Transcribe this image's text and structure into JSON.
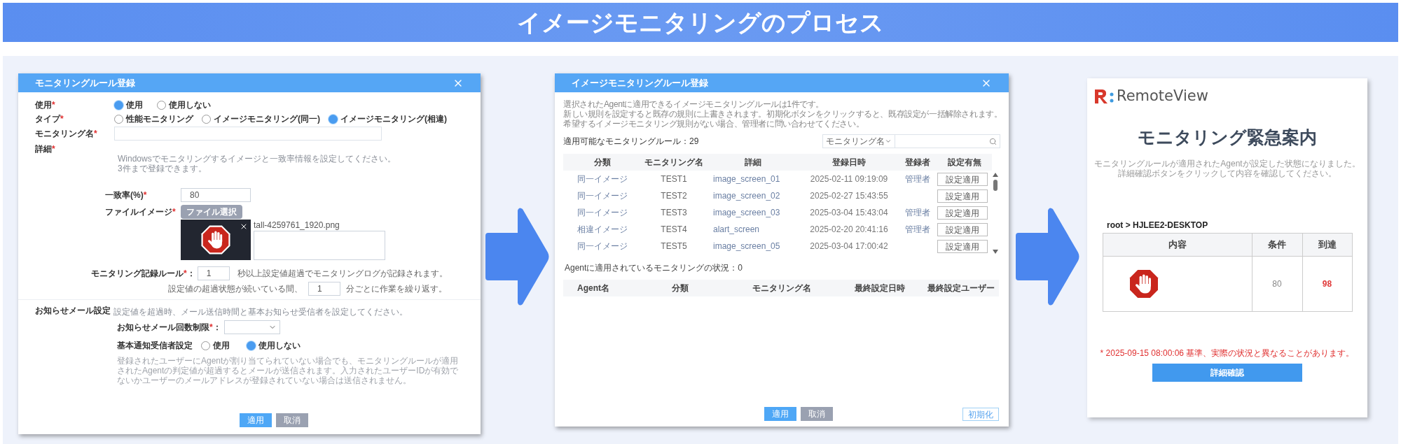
{
  "banner": {
    "title": "イメージモニタリングのプロセス"
  },
  "rule_dialog": {
    "title": "モニタリングルール登録",
    "use": {
      "label": "使用",
      "mark": "*",
      "options": [
        {
          "label": "使用",
          "selected": true
        },
        {
          "label": "使用しない",
          "selected": false
        }
      ]
    },
    "type": {
      "label": "タイプ",
      "mark": "*",
      "options": [
        {
          "label": "性能モニタリング",
          "selected": false
        },
        {
          "label": "イメージモニタリング(同一)",
          "selected": false
        },
        {
          "label": "イメージモニタリング(相違)",
          "selected": true
        }
      ]
    },
    "name": {
      "label": "モニタリング名",
      "mark": "*"
    },
    "detail": {
      "label": "詳細",
      "mark": "*",
      "hint_lines": [
        "Windowsでモニタリングするイメージと一致率情報を設定してください。",
        "3件まで登録できます。"
      ]
    },
    "match_rate": {
      "label": "一致率(%)",
      "mark": "*",
      "value": "80"
    },
    "file_image": {
      "label": "ファイルイメージ",
      "mark": "*",
      "button": "ファイル選択",
      "file_name": "tall-4259761_1920.png"
    },
    "record_rule": {
      "label": "モニタリング記録ルール",
      "mark": "*",
      "colon": "：",
      "value": "1",
      "suffix": "秒以上設定値超過でモニタリングログが記録されます。",
      "repeat_prefix": "設定値の超過状態が続いている間、",
      "repeat_value": "1",
      "repeat_suffix": "分ごとに作業を繰り返す。"
    },
    "mail": {
      "label": "お知らせメール設定",
      "hint": "設定値を超過時、メール送信時間と基本お知らせ受信者を設定してください。",
      "limit_label": "お知らせメール回数制限",
      "limit_mark": "*",
      "limit_colon": "：",
      "recipient_label": "基本通知受信者設定",
      "recipient_options": [
        {
          "label": "使用",
          "selected": false
        },
        {
          "label": "使用しない",
          "selected": true
        }
      ],
      "note": "登録されたユーザーにAgentが割り当てられていない場合でも、モニタリングルールが適用されたAgentの判定値が超過するとメールが送信されます。入力されたユーザーIDが有効でないかユーザーのメールアドレスが登録されていない場合は送信されません。"
    },
    "buttons": [
      {
        "label": "適用",
        "kind": "primary"
      },
      {
        "label": "取消",
        "kind": "secondary"
      }
    ]
  },
  "apply_dialog": {
    "title": "イメージモニタリングルール登録",
    "intro_lines": [
      "選択されたAgentに適用できるイメージモニタリングルールは1件です。",
      "新しい規則を設定すると既存の規則に上書きされます。初期化ボタンをクリックすると、既存設定が一括解除されます。",
      "希望するイメージモニタリング規則がない場合、管理者に問い合わせてください。"
    ],
    "available_count": "適用可能なモニタリングルール：29",
    "search_filter": "モニタリング名",
    "rules_columns": [
      "分類",
      "モニタリング名",
      "詳細",
      "登録日時",
      "登録者",
      "設定有無"
    ],
    "rules": [
      {
        "category": "同一イメージ",
        "name": "TEST1",
        "detail": "image_screen_01",
        "date": "2025-02-11 09:19:09",
        "registrant": "管理者",
        "action": "設定適用"
      },
      {
        "category": "同一イメージ",
        "name": "TEST2",
        "detail": "image_screen_02",
        "date": "2025-02-27 15:43:55",
        "action": "設定適用"
      },
      {
        "category": "同一イメージ",
        "name": "TEST3",
        "detail": "image_screen_03",
        "date": "2025-03-04 15:43:04",
        "registrant": "管理者",
        "action": "設定適用"
      },
      {
        "category": "相違イメージ",
        "name": "TEST4",
        "detail": "alart_screen",
        "date": "2025-02-20 20:41:16",
        "registrant": "管理者",
        "action": "設定適用"
      },
      {
        "category": "同一イメージ",
        "name": "TEST5",
        "detail": "image_screen_05",
        "date": "2025-03-04 17:00:42",
        "action": "設定適用"
      }
    ],
    "applied_status": "Agentに適用されているモニタリングの状況：0",
    "applied_columns": [
      "Agent名",
      "分類",
      "モニタリング名",
      "最終設定日時",
      "最終設定ユーザー"
    ],
    "buttons": [
      {
        "label": "適用",
        "kind": "primary"
      },
      {
        "label": "取消",
        "kind": "secondary"
      }
    ],
    "reset_button": "初期化"
  },
  "alert_card": {
    "logo": "RemoteView",
    "title": "モニタリング緊急案内",
    "message_lines": [
      "モニタリングルールが適用されたAgentが設定した状態になりました。",
      "詳細確認ボタンをクリックして内容を確認してください。"
    ],
    "path": "root > HJLEE2-DESKTOP",
    "columns": [
      "内容",
      "条件",
      "到達"
    ],
    "condition": "80",
    "reached": "98",
    "footnote": "* 2025-09-15 08:00:06 基準、実際の状況と異なることがあります。",
    "button": "詳細確認"
  }
}
